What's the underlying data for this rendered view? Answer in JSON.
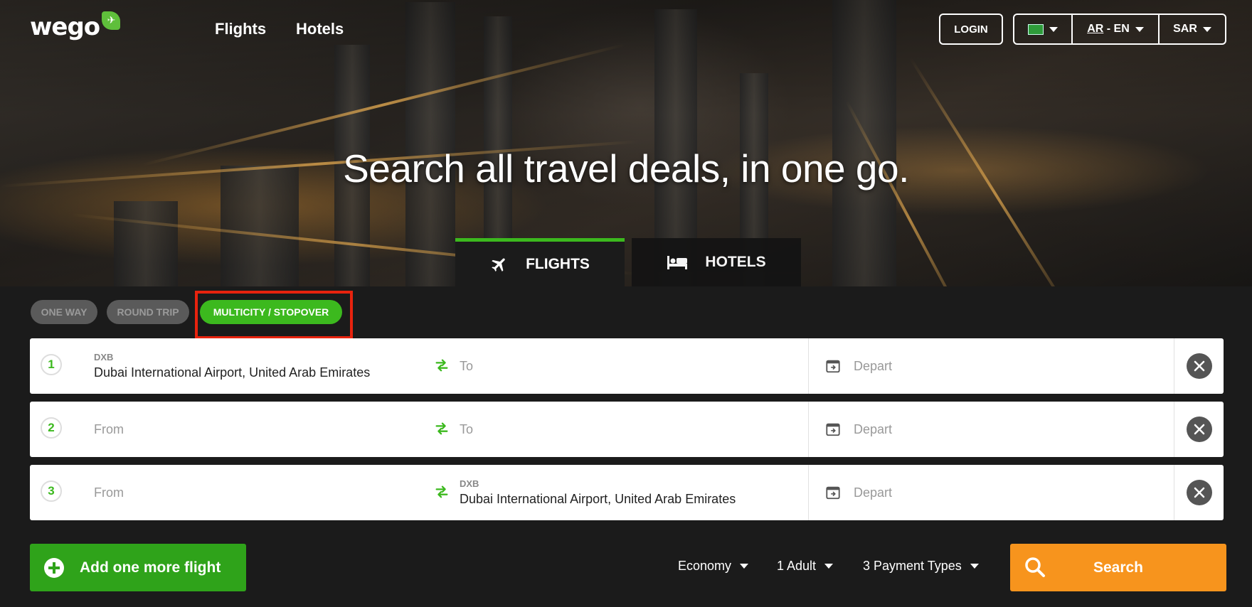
{
  "brand": {
    "logo_text": "wego"
  },
  "nav": {
    "flights": "Flights",
    "hotels": "Hotels"
  },
  "header": {
    "login": "LOGIN",
    "lang_ar": "AR",
    "lang_sep": " - ",
    "lang_en": "EN",
    "currency": "SAR"
  },
  "hero": {
    "headline": "Search all travel deals, in one go."
  },
  "tabs": {
    "flights": "FLIGHTS",
    "hotels": "HOTELS"
  },
  "trip_types": {
    "one_way": "ONE WAY",
    "round_trip": "ROUND TRIP",
    "multicity": "MULTICITY / STOPOVER"
  },
  "legs": [
    {
      "number": "1",
      "from_code": "DXB",
      "from_value": "Dubai International Airport, United Arab Emirates",
      "to_placeholder": "To",
      "depart_placeholder": "Depart"
    },
    {
      "number": "2",
      "from_placeholder": "From",
      "to_placeholder": "To",
      "depart_placeholder": "Depart"
    },
    {
      "number": "3",
      "from_placeholder": "From",
      "to_code": "DXB",
      "to_value": "Dubai International Airport, United Arab Emirates",
      "depart_placeholder": "Depart"
    }
  ],
  "footer": {
    "add_flight": "Add one more flight",
    "cabin": "Economy",
    "passengers": "1 Adult",
    "payment": "3 Payment Types",
    "search": "Search"
  },
  "colors": {
    "accent_green": "#3cb91e",
    "search_orange": "#f7941d",
    "highlight_red": "#e8230e"
  }
}
